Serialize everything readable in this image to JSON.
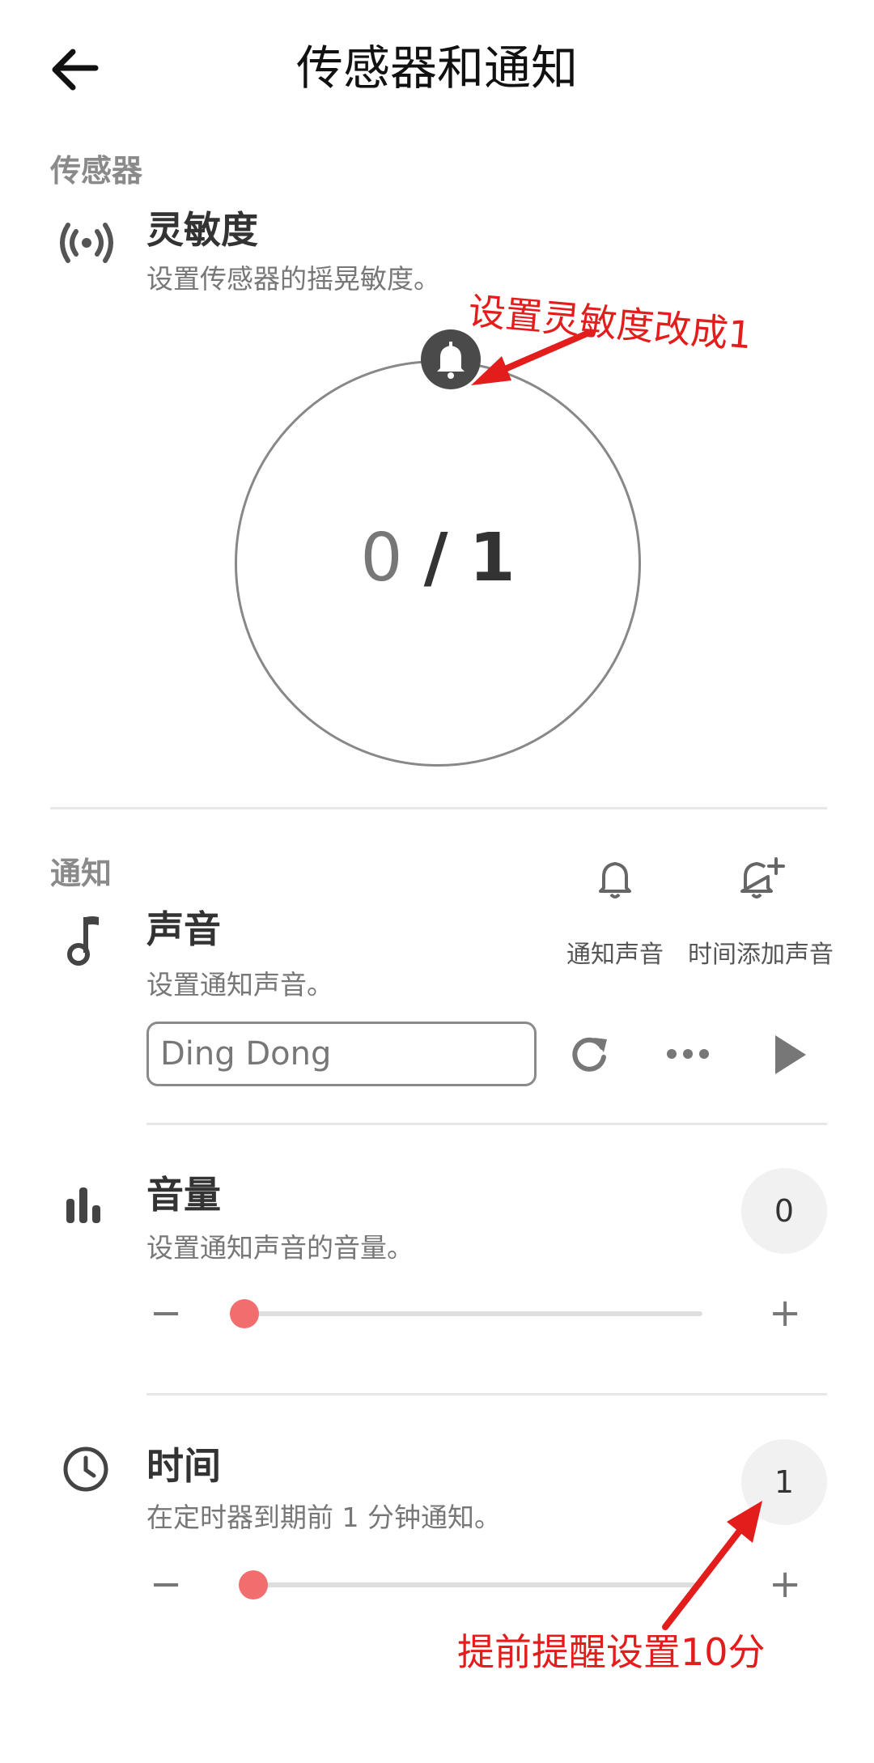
{
  "header": {
    "title": "传感器和通知",
    "back_icon": "arrow-left-icon"
  },
  "sensor_section": {
    "label": "传感器",
    "sensitivity": {
      "title": "灵敏度",
      "description": "设置传感器的摇晃敏度。",
      "current": "0",
      "separator": "/",
      "max": "1",
      "annotation": "设置灵敏度改成1"
    }
  },
  "notification_section": {
    "label": "通知",
    "actions": [
      {
        "label": "通知声音",
        "icon": "bell-icon"
      },
      {
        "label": "时间添加声音",
        "icon": "bell-plus-icon"
      }
    ],
    "sound": {
      "title": "声音",
      "description": "设置通知声音。",
      "value": "Ding Dong"
    },
    "volume": {
      "title": "音量",
      "description": "设置通知声音的音量。",
      "value": "0",
      "level": 0,
      "minus": "−",
      "plus": "+"
    },
    "time": {
      "title": "时间",
      "description": "在定时器到期前 1 分钟通知。",
      "value": "1",
      "level": 0.02,
      "minus": "−",
      "plus": "+",
      "annotation": "提前提醒设置10分"
    }
  },
  "colors": {
    "accent": "#f26e6e",
    "annotation": "#e31c1c",
    "knob": "#4a4a4a"
  }
}
